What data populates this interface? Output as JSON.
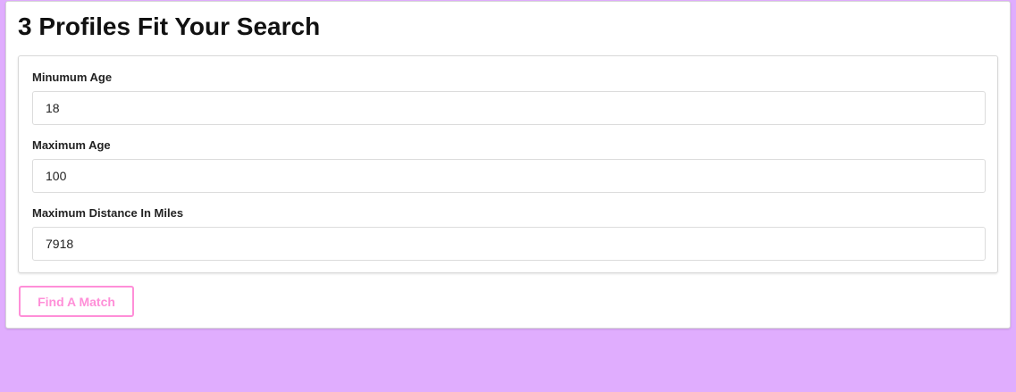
{
  "page": {
    "title": "3 Profiles Fit Your Search"
  },
  "form": {
    "min_age": {
      "label": "Minumum Age",
      "value": "18"
    },
    "max_age": {
      "label": "Maximum Age",
      "value": "100"
    },
    "max_distance": {
      "label": "Maximum Distance In Miles",
      "value": "7918"
    }
  },
  "actions": {
    "find_match_label": "Find A Match"
  },
  "colors": {
    "page_background": "#e0adfe",
    "button_accent": "#ff8fd8"
  }
}
